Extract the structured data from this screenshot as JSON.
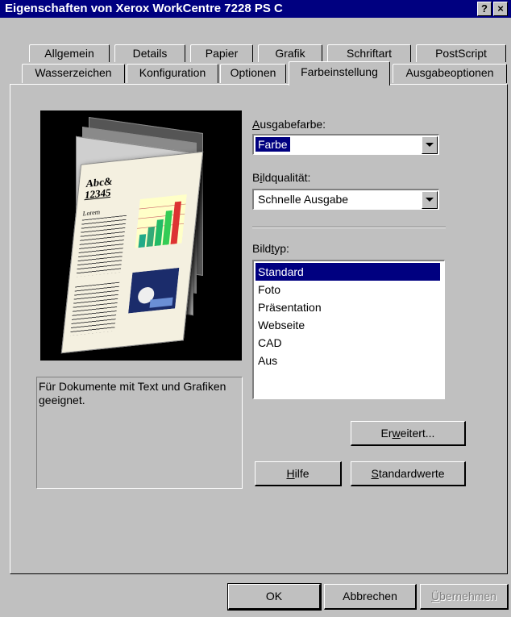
{
  "window": {
    "title": "Eigenschaften von Xerox WorkCentre 7228 PS C",
    "help_btn": "?",
    "close_btn": "×"
  },
  "tabs_row1": [
    "Allgemein",
    "Details",
    "Papier",
    "Grafik",
    "Schriftart",
    "PostScript"
  ],
  "tabs_row2": [
    "Wasserzeichen",
    "Konfiguration",
    "Optionen",
    "Farbeinstellung",
    "Ausgabeoptionen"
  ],
  "active_tab": "Farbeinstellung",
  "preview": {
    "doc_text1": "Abc&",
    "doc_text2": "12345",
    "doc_text3": "Lorem"
  },
  "description": "Für Dokumente mit Text und Grafiken geeignet.",
  "ausgabefarbe": {
    "label_pre": "",
    "label_key": "A",
    "label_post": "usgabefarbe:",
    "value": "Farbe"
  },
  "bildqualitaet": {
    "label_pre": "B",
    "label_key": "i",
    "label_post": "ldqualität:",
    "value": "Schnelle Ausgabe"
  },
  "bildtyp": {
    "label_pre": "Bild",
    "label_key": "t",
    "label_post": "yp:",
    "items": [
      "Standard",
      "Foto",
      "Präsentation",
      "Webseite",
      "CAD",
      "Aus"
    ],
    "selected": "Standard"
  },
  "buttons": {
    "erweitert_pre": "Er",
    "erweitert_key": "w",
    "erweitert_post": "eitert...",
    "hilfe_key": "H",
    "hilfe_post": "ilfe",
    "standardwerte_key": "S",
    "standardwerte_post": "tandardwerte",
    "ok": "OK",
    "abbrechen": "Abbrechen",
    "uebernehmen_key": "Ü",
    "uebernehmen_post": "bernehmen"
  }
}
